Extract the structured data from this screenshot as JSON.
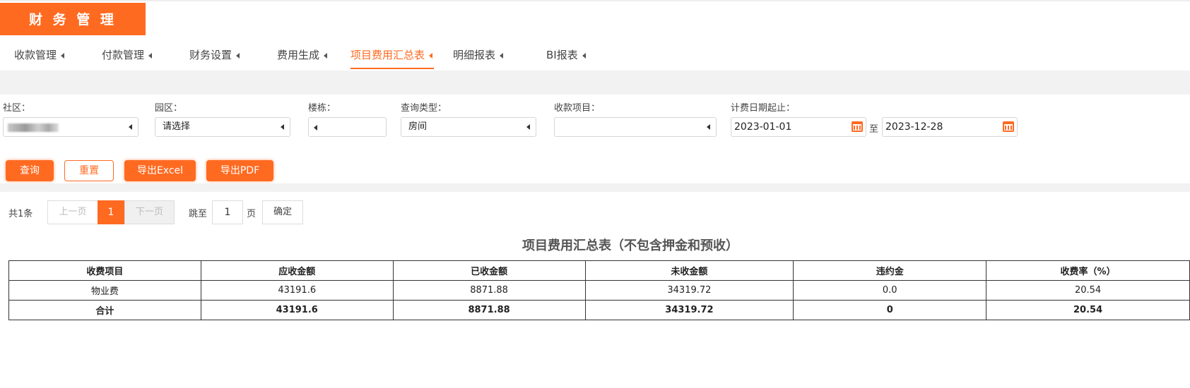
{
  "brand": "财 务 管 理",
  "nav": [
    {
      "label": "收款管理"
    },
    {
      "label": "付款管理"
    },
    {
      "label": "财务设置"
    },
    {
      "label": "费用生成"
    },
    {
      "label": "项目费用汇总表"
    },
    {
      "label": "明细报表"
    },
    {
      "label": "BI报表"
    }
  ],
  "filters": {
    "community_label": "社区：",
    "park_label": "园区：",
    "park_value": "请选择",
    "building_label": "楼栋：",
    "query_type_label": "查询类型：",
    "query_type_value": "房间",
    "charge_item_label": "收款项目：",
    "date_range_label": "计费日期起止：",
    "date_start": "2023-01-01",
    "date_to": "至",
    "date_end": "2023-12-28"
  },
  "buttons": {
    "query": "查询",
    "reset": "重置",
    "export_excel": "导出Excel",
    "export_pdf": "导出PDF"
  },
  "pager": {
    "total": "共1条",
    "prev": "上一页",
    "current": "1",
    "next": "下一页",
    "jump_label": "跳至",
    "jump_value": "1",
    "page_unit": "页",
    "confirm": "确定"
  },
  "report": {
    "title": "项目费用汇总表（不包含押金和预收）",
    "headers": [
      "收费项目",
      "应收金额",
      "已收金额",
      "未收金额",
      "违约金",
      "收费率（%）"
    ],
    "rows": [
      [
        "物业费",
        "43191.6",
        "8871.88",
        "34319.72",
        "0.0",
        "20.54"
      ]
    ],
    "total_row": [
      "合计",
      "43191.6",
      "8871.88",
      "34319.72",
      "0",
      "20.54"
    ]
  },
  "colors": {
    "accent": "#ff6a21"
  }
}
